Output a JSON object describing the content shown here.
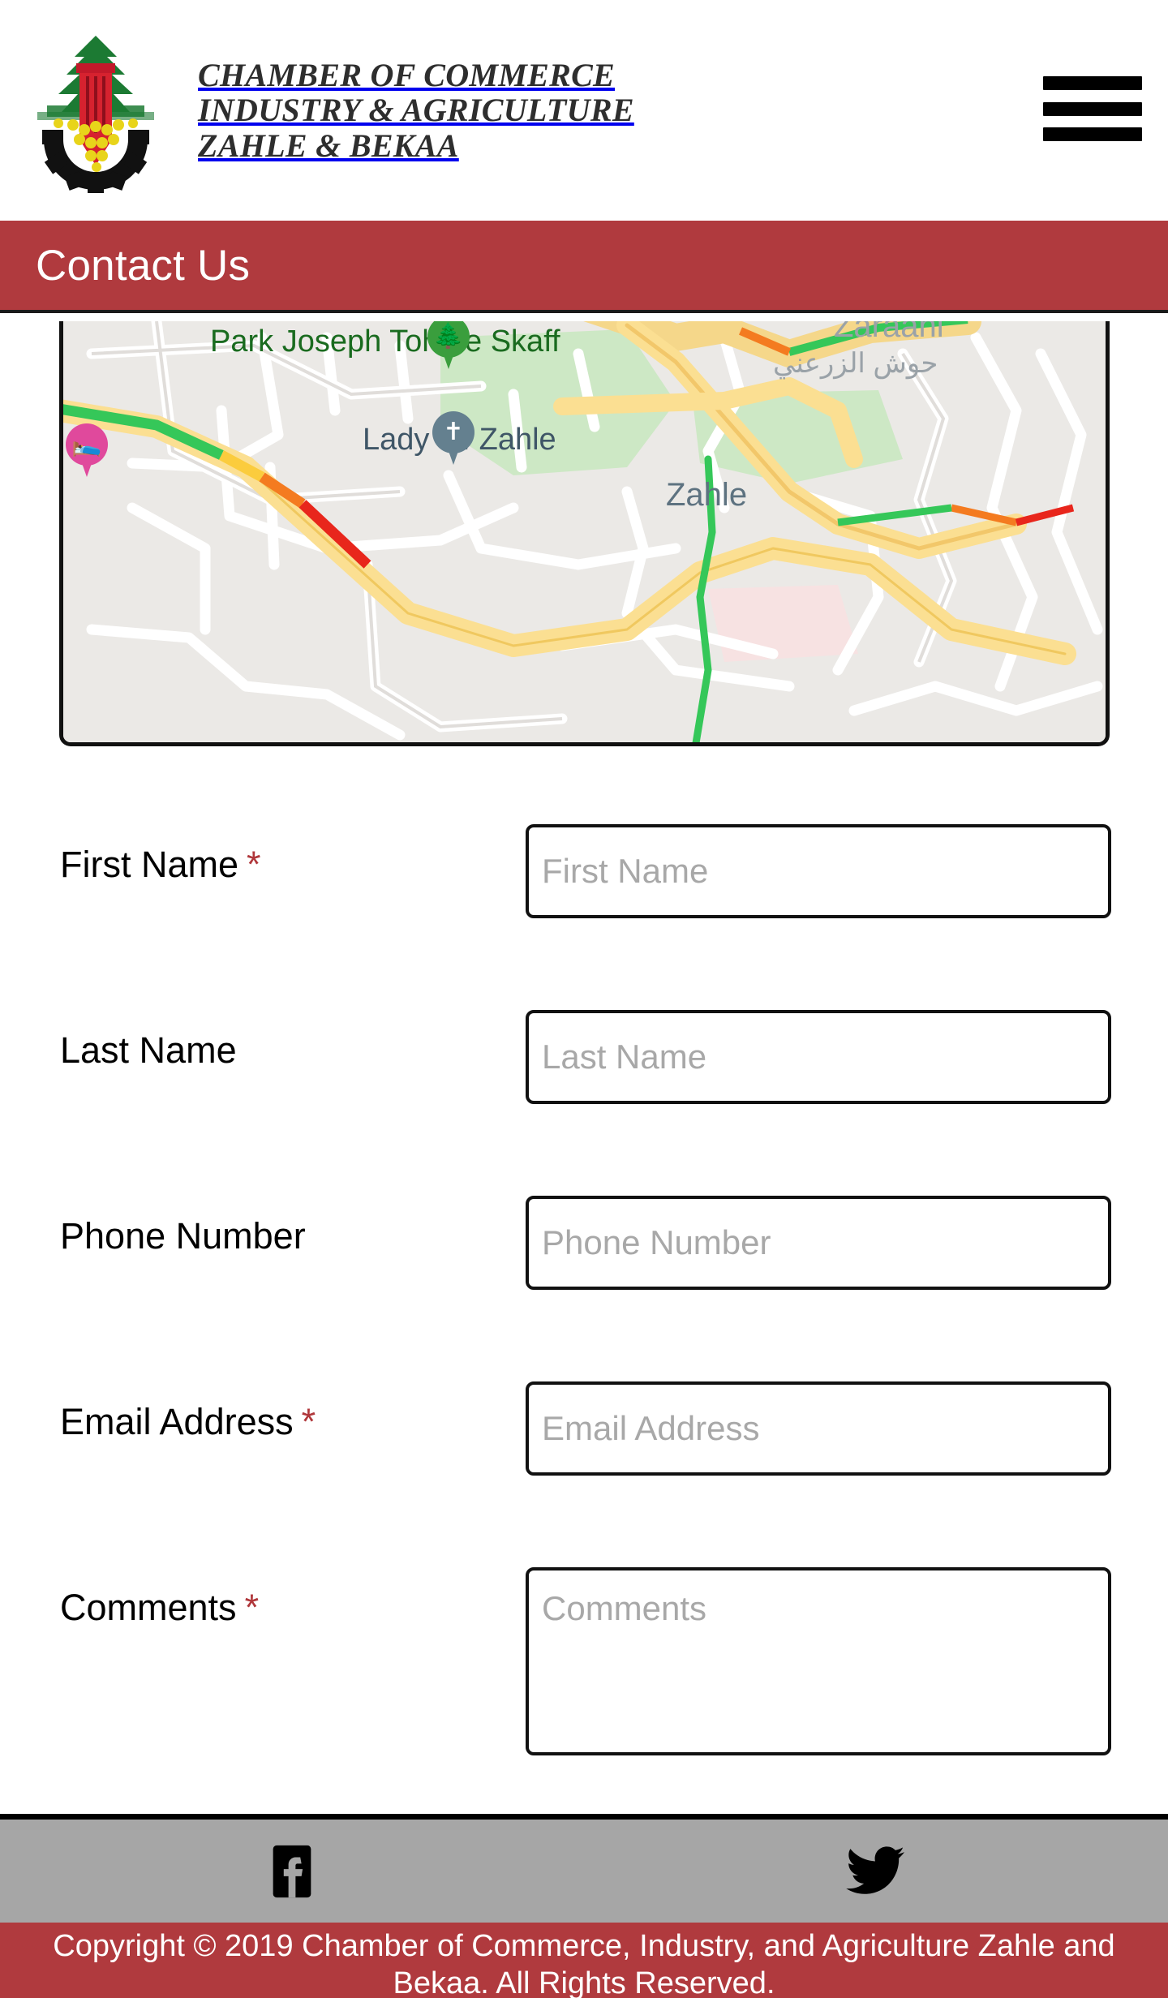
{
  "header": {
    "logo_icon": "cedar-column-gear-logo",
    "brand_line1": "CHAMBER OF COMMERCE",
    "brand_line2": "INDUSTRY & AGRICULTURE",
    "brand_line3": "ZAHLE & BEKAA",
    "menu_icon": "hamburger-menu-icon"
  },
  "banner": {
    "title": "Contact Us",
    "background": "#b03a3e",
    "text_color": "#ffffff"
  },
  "map": {
    "labels": {
      "park": "Park Joseph Tohme Skaff",
      "church": "Lady Of Zahle",
      "district_en": "Zaraani",
      "district_ar": "حوش الزرعني",
      "city": "Zahle"
    },
    "markers": [
      {
        "name": "park-marker",
        "icon": "tree-icon",
        "color": "#3a9e3d"
      },
      {
        "name": "church-marker",
        "icon": "cross-icon",
        "color": "#64808f"
      },
      {
        "name": "hotel-marker",
        "icon": "bed-icon",
        "color": "#e0499c"
      }
    ]
  },
  "form": {
    "fields": [
      {
        "label": "First Name",
        "required": true,
        "placeholder": "First Name",
        "value": "",
        "type": "text"
      },
      {
        "label": "Last Name",
        "required": false,
        "placeholder": "Last Name",
        "value": "",
        "type": "text"
      },
      {
        "label": "Phone Number",
        "required": false,
        "placeholder": "Phone Number",
        "value": "",
        "type": "text"
      },
      {
        "label": "Email Address",
        "required": true,
        "placeholder": "Email Address",
        "value": "",
        "type": "text"
      },
      {
        "label": "Comments",
        "required": true,
        "placeholder": "Comments",
        "value": "",
        "type": "textarea"
      }
    ],
    "required_marker": "*",
    "required_color": "#b0373b"
  },
  "footer": {
    "social": [
      {
        "name": "facebook",
        "icon": "facebook-icon"
      },
      {
        "name": "twitter",
        "icon": "twitter-icon"
      }
    ],
    "social_bar_background": "#a6a6a6",
    "copyright": "Copyright © 2019 Chamber of Commerce, Industry, and Agriculture Zahle and Bekaa. All Rights Reserved.",
    "copyright_background": "#b03a3e"
  }
}
